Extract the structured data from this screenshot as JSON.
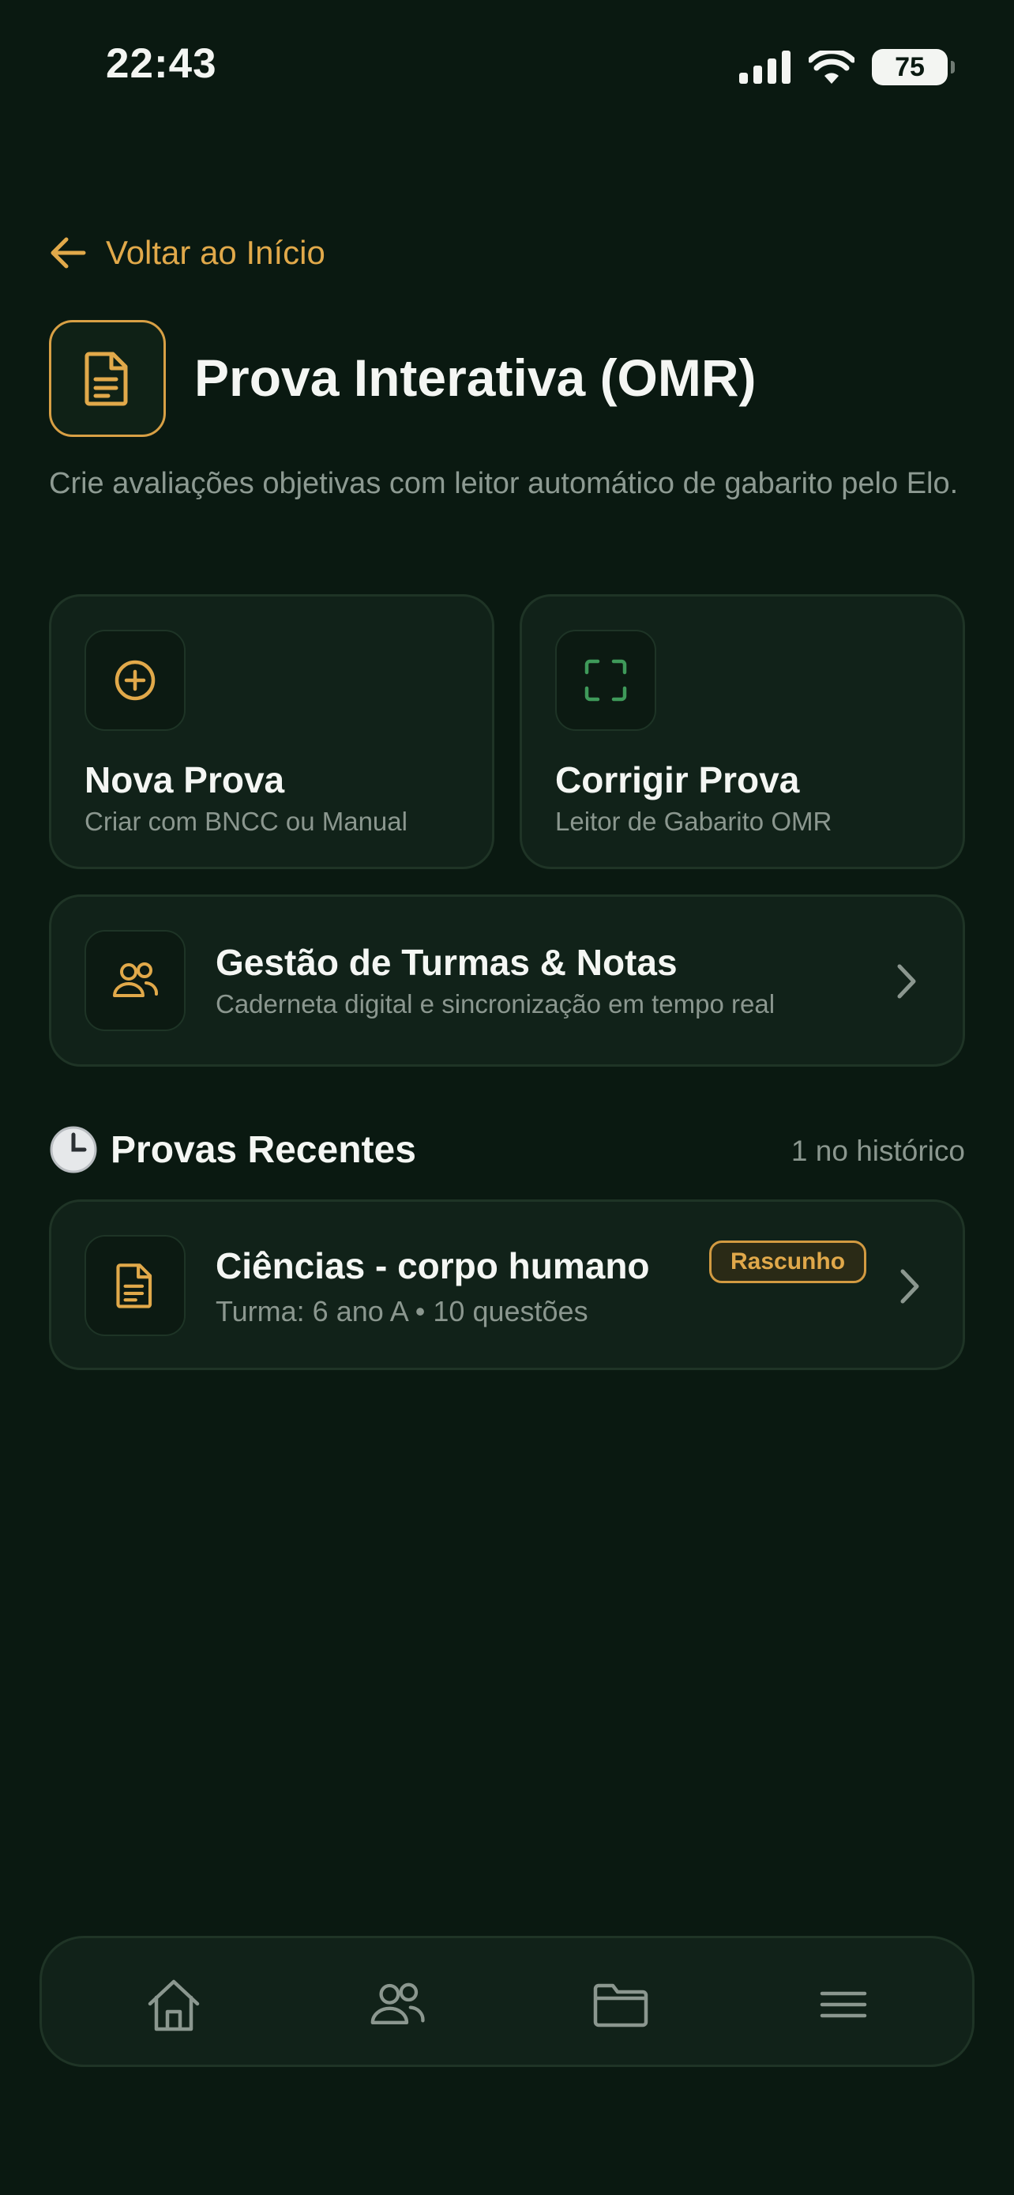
{
  "status": {
    "time": "22:43",
    "battery": "75"
  },
  "back": {
    "label": "Voltar ao Início"
  },
  "header": {
    "title": "Prova Interativa (OMR)",
    "subtitle": "Crie avaliações objetivas com leitor automático de gabarito pelo Elo."
  },
  "actions": [
    {
      "title": "Nova Prova",
      "subtitle": "Criar com BNCC ou Manual",
      "icon": "plus-circle-icon"
    },
    {
      "title": "Corrigir Prova",
      "subtitle": "Leitor de Gabarito OMR",
      "icon": "scan-icon"
    }
  ],
  "classes": {
    "title": "Gestão de Turmas & Notas",
    "subtitle": "Caderneta digital e sincronização em tempo real",
    "icon": "users-icon"
  },
  "recent": {
    "title": "Provas Recentes",
    "count": "1 no histórico",
    "items": [
      {
        "title": "Ciências - corpo humano",
        "meta": "Turma: 6 ano A • 10 questões",
        "badge": "Rascunho",
        "icon": "document-icon"
      }
    ]
  },
  "nav": [
    "home-icon",
    "users-icon",
    "folder-icon",
    "menu-icon"
  ],
  "colors": {
    "background": "#0a1911",
    "card": "#112219",
    "accent": "#e1a94a",
    "green": "#3f9a5a"
  }
}
